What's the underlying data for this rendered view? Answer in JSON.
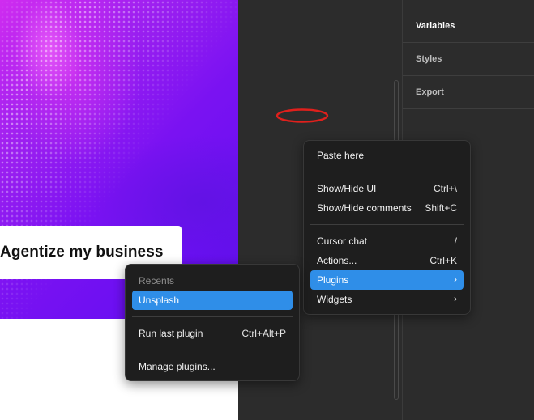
{
  "canvas": {
    "cta_text": "Agentize my business"
  },
  "right_panel": {
    "items": [
      {
        "label": "Variables"
      },
      {
        "label": "Styles"
      },
      {
        "label": "Export"
      }
    ]
  },
  "context_menu": {
    "items": [
      {
        "label": "Paste here",
        "shortcut": ""
      },
      {
        "label": "Show/Hide UI",
        "shortcut": "Ctrl+\\"
      },
      {
        "label": "Show/Hide comments",
        "shortcut": "Shift+C"
      },
      {
        "label": "Cursor chat",
        "shortcut": "/"
      },
      {
        "label": "Actions...",
        "shortcut": "Ctrl+K"
      },
      {
        "label": "Plugins",
        "submenu": "›"
      },
      {
        "label": "Widgets",
        "submenu": "›"
      }
    ]
  },
  "plugins_submenu": {
    "recents_heading": "Recents",
    "recent_items": [
      {
        "label": "Unsplash"
      }
    ],
    "run_last": {
      "label": "Run last plugin",
      "shortcut": "Ctrl+Alt+P"
    },
    "manage": {
      "label": "Manage plugins..."
    }
  },
  "colors": {
    "accent": "#2f8ee8",
    "menu_bg": "#1e1e1e",
    "panel_bg": "#2c2c2c",
    "annotation": "#e0201c"
  }
}
